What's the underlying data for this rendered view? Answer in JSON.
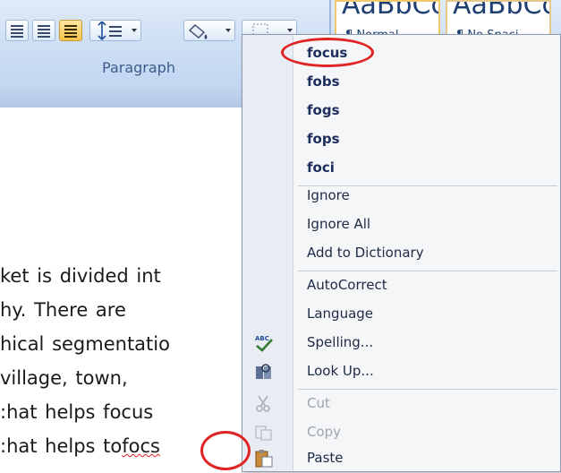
{
  "ribbon": {
    "group_label": "Paragraph",
    "styles": [
      {
        "sample": "AaBbCc",
        "name": "¶ Normal"
      },
      {
        "sample": "AaBbCc",
        "name": "¶ No Spaci"
      }
    ]
  },
  "document": {
    "lines": [
      "ket is divided int",
      "hy.  There  are",
      "hical segmentatio",
      " village,  town,",
      ":hat helps focus",
      ":hat helps to"
    ],
    "misspelled_word": "focs"
  },
  "context_menu": {
    "suggestions": [
      "focus",
      "fobs",
      "fogs",
      "fops",
      "foci"
    ],
    "items": [
      {
        "label": "Ignore",
        "icon": "",
        "disabled": false
      },
      {
        "label": "Ignore All",
        "icon": "",
        "disabled": false
      },
      {
        "label": "Add to Dictionary",
        "icon": "",
        "disabled": false
      },
      {
        "label": "AutoCorrect",
        "icon": "",
        "disabled": false
      },
      {
        "label": "Language",
        "icon": "",
        "disabled": false
      },
      {
        "label": "Spelling...",
        "icon": "spelling-check-icon",
        "disabled": false
      },
      {
        "label": "Look Up...",
        "icon": "research-book-icon",
        "disabled": false
      },
      {
        "label": "Cut",
        "icon": "scissors-icon",
        "disabled": true
      },
      {
        "label": "Copy",
        "icon": "copy-pages-icon",
        "disabled": true
      },
      {
        "label": "Paste",
        "icon": "clipboard-paste-icon",
        "disabled": false
      }
    ]
  },
  "colors": {
    "annotation_circle": "#e02424",
    "squiggle": "#e02020",
    "ribbon_bg": "#c9dcf3"
  }
}
